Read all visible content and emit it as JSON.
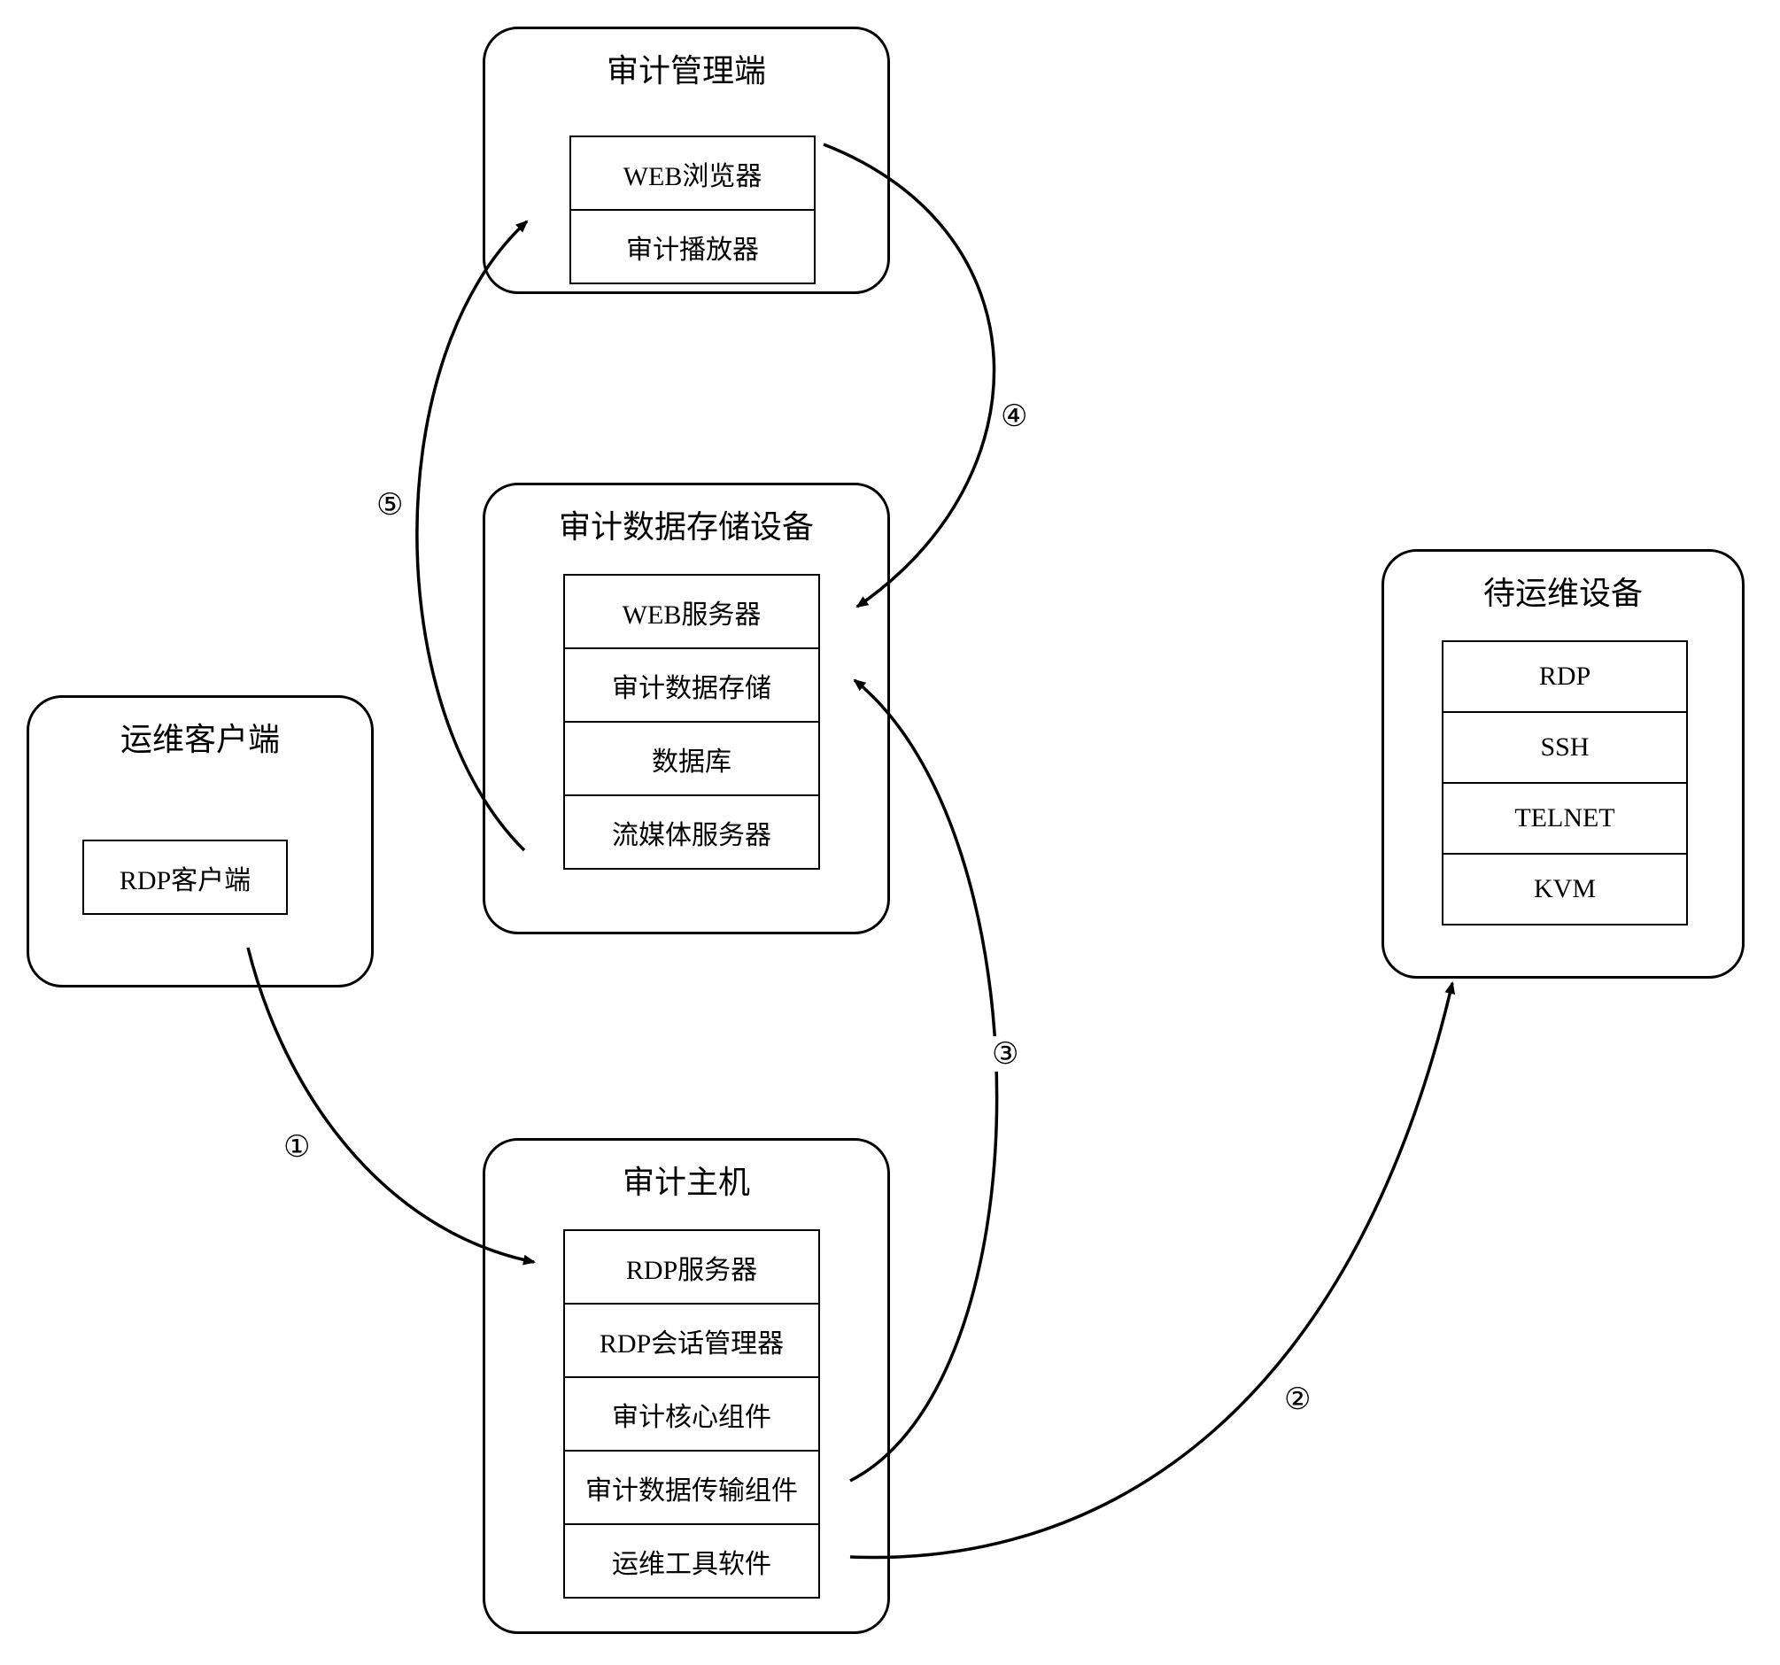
{
  "nodes": {
    "audit_mgmt": {
      "title": "审计管理端",
      "slots": [
        "WEB浏览器",
        "审计播放器"
      ]
    },
    "audit_storage": {
      "title": "审计数据存储设备",
      "slots": [
        "WEB服务器",
        "审计数据存储",
        "数据库",
        "流媒体服务器"
      ]
    },
    "ops_client": {
      "title": "运维客户端",
      "slots": [
        "RDP客户端"
      ]
    },
    "audit_host": {
      "title": "审计主机",
      "slots": [
        "RDP服务器",
        "RDP会话管理器",
        "审计核心组件",
        "审计数据传输组件",
        "运维工具软件"
      ]
    },
    "target_dev": {
      "title": "待运维设备",
      "slots": [
        "RDP",
        "SSH",
        "TELNET",
        "KVM"
      ]
    }
  },
  "edges": {
    "e1": "①",
    "e2": "②",
    "e3": "③",
    "e4": "④",
    "e5": "⑤"
  }
}
